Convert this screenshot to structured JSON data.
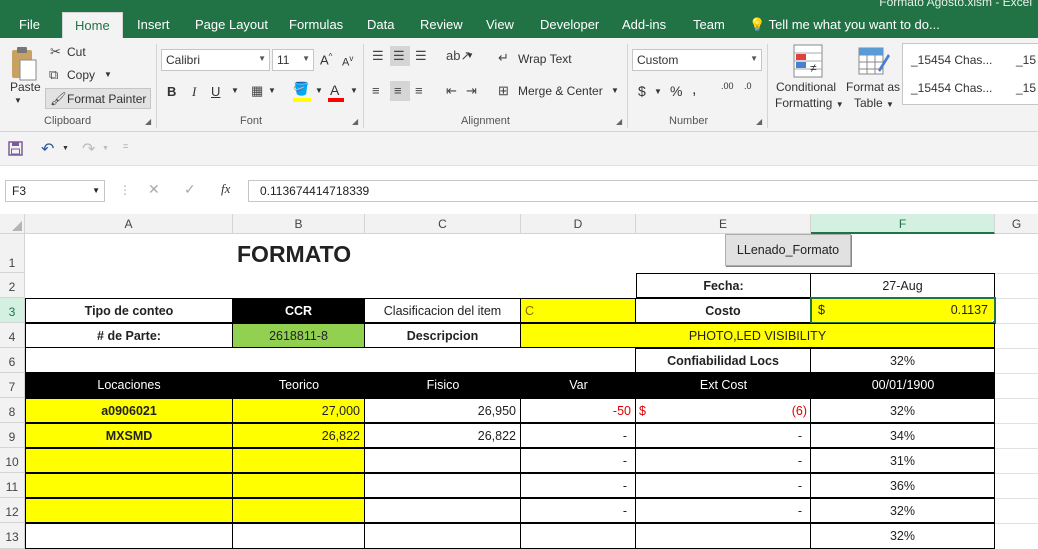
{
  "doc_title": "Formato Agosto.xlsm - Excel",
  "tabs": [
    "File",
    "Home",
    "Insert",
    "Page Layout",
    "Formulas",
    "Data",
    "Review",
    "View",
    "Developer",
    "Add-ins",
    "Team"
  ],
  "tell_me": "Tell me what you want to do...",
  "clipboard": {
    "paste": "Paste",
    "cut": "Cut",
    "copy": "Copy",
    "format_painter": "Format Painter",
    "label": "Clipboard"
  },
  "font": {
    "name": "Calibri",
    "size": "11",
    "label": "Font",
    "bold": "B",
    "italic": "I",
    "underline": "U"
  },
  "alignment": {
    "wrap": "Wrap Text",
    "merge": "Merge & Center",
    "label": "Alignment"
  },
  "number": {
    "format": "Custom",
    "label": "Number",
    "dollar": "$",
    "percent": "%",
    "comma": ",",
    "inc_dec": ".00",
    "dec_dec": ".0"
  },
  "styles": {
    "conditional": "Conditional",
    "formatting": "Formatting",
    "format_as": "Format as",
    "table": "Table",
    "style1": "_15454 Chas...",
    "style2": "_15454 Chas...",
    "style3": "_15",
    "style4": "_15"
  },
  "name_box": "F3",
  "formula": "0.113674414718339",
  "columns": [
    "A",
    "B",
    "C",
    "D",
    "E",
    "F",
    "G"
  ],
  "rows": [
    "1",
    "2",
    "3",
    "4",
    "6",
    "7",
    "8",
    "9",
    "10",
    "11",
    "12",
    "13"
  ],
  "button_llenado": "LLenado_Formato",
  "sheet": {
    "formato": "FORMATO",
    "fecha_label": "Fecha:",
    "fecha_value": "27-Aug",
    "tipo_conteo": "Tipo de conteo",
    "ccr": "CCR",
    "clasificacion": "Clasificacion del item",
    "clasificacion_val": "C",
    "costo_label": "Costo",
    "costo_sign": "$",
    "costo_value": "0.1137",
    "parte_label": "# de Parte:",
    "parte_value": "2618811-8",
    "descripcion": "Descripcion",
    "descripcion_value": "PHOTO,LED VISIBILITY",
    "confiabilidad": "Confiabilidad Locs",
    "confiabilidad_val": "32%",
    "headers": [
      "Locaciones",
      "Teorico",
      "Fisico",
      "Var",
      "Ext Cost",
      "00/01/1900"
    ],
    "data_rows": [
      {
        "loc": "a0906021",
        "teorico": "27,000",
        "fisico": "26,950",
        "var": "-50",
        "ext_sign": "$",
        "ext": "(6)",
        "pct": "32%"
      },
      {
        "loc": "MXSMD",
        "teorico": "26,822",
        "fisico": "26,822",
        "var": "-",
        "ext_sign": "",
        "ext": "-",
        "pct": "34%"
      },
      {
        "loc": "",
        "teorico": "",
        "fisico": "",
        "var": "-",
        "ext_sign": "",
        "ext": "-",
        "pct": "31%"
      },
      {
        "loc": "",
        "teorico": "",
        "fisico": "",
        "var": "-",
        "ext_sign": "",
        "ext": "-",
        "pct": "36%"
      },
      {
        "loc": "",
        "teorico": "",
        "fisico": "",
        "var": "-",
        "ext_sign": "",
        "ext": "-",
        "pct": "32%"
      },
      {
        "loc": "",
        "teorico": "",
        "fisico": "",
        "var": "",
        "ext_sign": "",
        "ext": "",
        "pct": "32%"
      }
    ]
  }
}
